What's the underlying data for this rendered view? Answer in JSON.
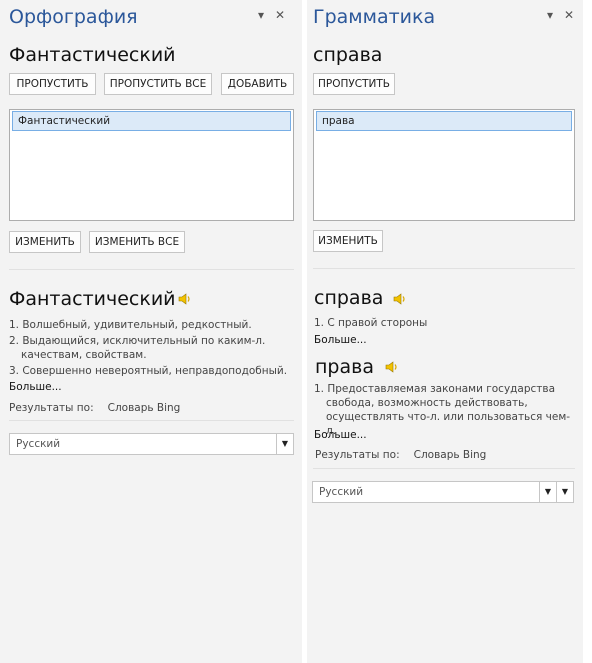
{
  "spelling": {
    "title": "Орфография",
    "word": "Фантастический",
    "buttons": {
      "ignore": "ПРОПУСТИТЬ",
      "ignore_all": "ПРОПУСТИТЬ ВСЕ",
      "add": "ДОБАВИТЬ",
      "change": "ИЗМЕНИТЬ",
      "change_all": "ИЗМЕНИТЬ ВСЕ"
    },
    "suggestions": [
      "Фантастический"
    ],
    "dictionary": {
      "word": "Фантастический",
      "definitions": [
        "1. Волшебный, удивительный, редкостный.",
        "2. Выдающийся, исключительный по каким-л. качествам, свойствам.",
        "3. Совершенно невероятный, неправдоподобный."
      ],
      "more": "Больше..."
    },
    "results_label": "Результаты по:",
    "results_source": "Словарь Bing",
    "language": "Русский"
  },
  "grammar": {
    "title": "Грамматика",
    "word": "справа",
    "buttons": {
      "change": "ИЗМЕНИТЬ"
    },
    "suggestions": [
      "права"
    ],
    "entries": [
      {
        "word": "справа",
        "definitions": [
          "1. С правой стороны"
        ],
        "more": "Больше..."
      },
      {
        "word": "права",
        "definitions": [
          "1. Предоставляемая законами государства свобода, возможность действовать, осуществлять что-л. или пользоваться чем-л."
        ],
        "more": "Больше..."
      }
    ],
    "results_label": "Результаты по:",
    "results_source": "Словарь Bing",
    "language": "Русский"
  },
  "controls": {
    "pin_glyph": "▾",
    "close_glyph": "✕",
    "dropdown_glyph": "▼"
  },
  "colors": {
    "accent": "#2b579a",
    "selection": "#dceaf8",
    "selection_border": "#78aee5"
  }
}
